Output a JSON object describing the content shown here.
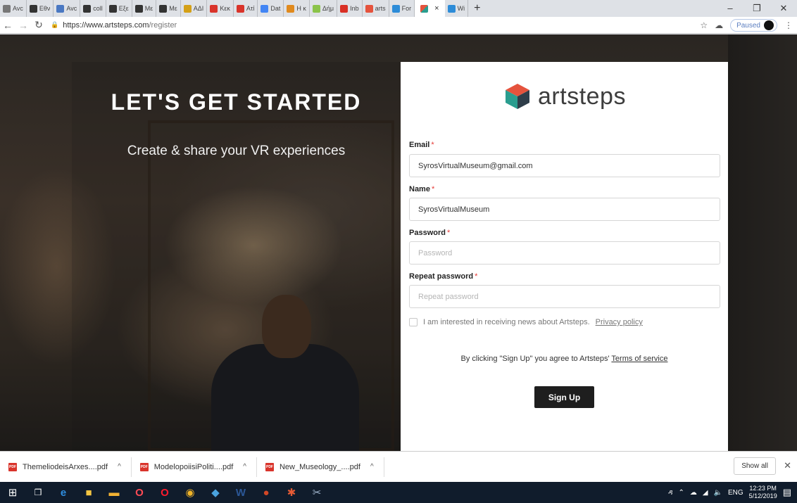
{
  "browser": {
    "tabs": [
      {
        "label": "Avc",
        "color": "#777777"
      },
      {
        "label": "Εθν",
        "color": "#333333"
      },
      {
        "label": "Avc",
        "color": "#4a78c2"
      },
      {
        "label": "coll",
        "color": "#333333"
      },
      {
        "label": "Εξε",
        "color": "#333333"
      },
      {
        "label": "Με",
        "color": "#333333"
      },
      {
        "label": "Με",
        "color": "#333333"
      },
      {
        "label": "ΑΔΙ",
        "color": "#d4a017"
      },
      {
        "label": "Κεκ",
        "color": "#d9342b"
      },
      {
        "label": "Ατί",
        "color": "#d9342b"
      },
      {
        "label": "Dat",
        "color": "#4285f4"
      },
      {
        "label": "Η κ",
        "color": "#e08a1e"
      },
      {
        "label": "Δήμ",
        "color": "#8bc34a"
      },
      {
        "label": "Inb",
        "color": "#d93025"
      },
      {
        "label": "arts",
        "color": "#e5533d"
      },
      {
        "label": "For",
        "color": "#2d8cd8"
      }
    ],
    "active_tab_close": "×",
    "after_tab": {
      "label": "Wi",
      "color": "#2d8cd8"
    },
    "new_tab": "+",
    "window_controls": {
      "minimize": "–",
      "maximize": "❐",
      "close": "✕"
    },
    "url_host": "https://www.artsteps.com",
    "url_path": "/register",
    "paused_label": "Paused"
  },
  "hero": {
    "headline": "LET'S GET STARTED",
    "subline": "Create & share your VR experiences"
  },
  "form": {
    "logo_text": "artsteps",
    "email": {
      "label": "Email",
      "required": "*",
      "value": "SyrosVirtualMuseum@gmail.com"
    },
    "name": {
      "label": "Name",
      "required": "*",
      "value": "SyrosVirtualMuseum"
    },
    "password": {
      "label": "Password",
      "required": "*",
      "placeholder": "Password"
    },
    "repeat_password": {
      "label": "Repeat password",
      "required": "*",
      "placeholder": "Repeat password"
    },
    "newsletter_text": "I am interested in receiving news about Artsteps.",
    "privacy_link": "Privacy policy",
    "terms_text": "By clicking \"Sign Up\" you agree to Artsteps'",
    "terms_link": "Terms of service",
    "signup_label": "Sign Up"
  },
  "downloads": {
    "items": [
      {
        "name": "ThemeliodeisArxes....pdf"
      },
      {
        "name": "ModelopoiisiPoliti....pdf"
      },
      {
        "name": "New_Museology_....pdf"
      }
    ],
    "show_all": "Show all",
    "close": "✕"
  },
  "taskbar": {
    "language": "ENG",
    "time": "12:23 PM",
    "date": "5/12/2019"
  }
}
